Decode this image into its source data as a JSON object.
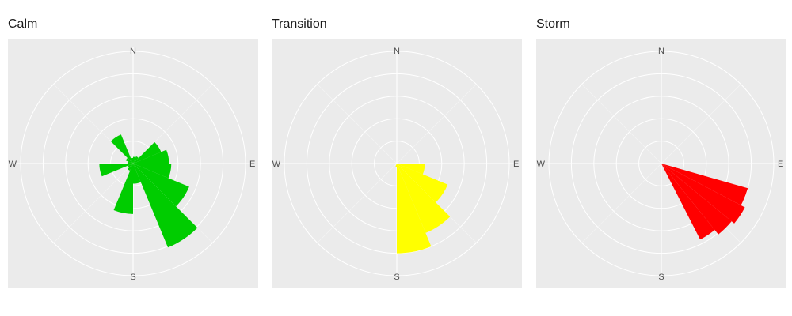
{
  "chart_data": [
    {
      "type": "rose",
      "title": "Calm",
      "color": "#00cc00",
      "directions": [
        "N",
        "E",
        "S",
        "W"
      ],
      "rmax": 5,
      "sectors_start_deg": 0,
      "sector_width_deg": 22.5,
      "values": [
        0.3,
        0.35,
        1.35,
        1.6,
        1.7,
        2.7,
        4.05,
        0.9,
        2.25,
        0.35,
        0.25,
        1.5,
        0.25,
        0.35,
        1.4,
        0.25
      ]
    },
    {
      "type": "rose",
      "title": "Transition",
      "color": "#ffff00",
      "directions": [
        "N",
        "E",
        "S",
        "W"
      ],
      "rmax": 5,
      "sectors_start_deg": 0,
      "sector_width_deg": 22.5,
      "values": [
        0,
        0,
        0,
        0,
        1.25,
        2.45,
        3.35,
        4.0,
        0.15,
        0,
        0,
        0,
        0,
        0,
        0,
        0
      ]
    },
    {
      "type": "rose",
      "title": "Storm",
      "color": "#ff0000",
      "directions": [
        "N",
        "E",
        "S",
        "W"
      ],
      "rmax": 5,
      "sectors_start_deg": 0,
      "sector_width_deg": 22.5,
      "values": [
        0,
        0,
        0,
        0,
        0,
        0,
        4.0,
        0,
        0,
        0,
        0,
        0,
        0,
        0,
        0,
        0
      ],
      "sector_override": {
        "start_deg": 106,
        "end_deg": 153,
        "values_outer": [
          4.0,
          4.2,
          4.05,
          3.8
        ]
      }
    }
  ]
}
